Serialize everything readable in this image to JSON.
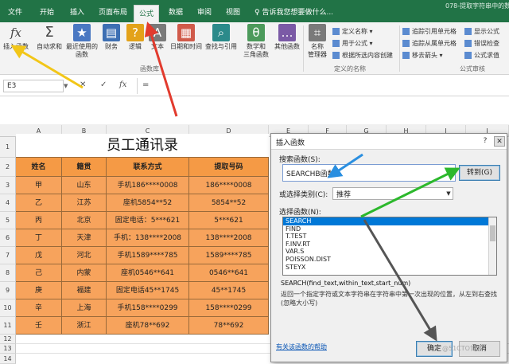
{
  "window": {
    "title_fragment": "078-提取字符串中的数字..."
  },
  "tabs": [
    {
      "label": "文件",
      "active": false
    },
    {
      "label": "开始",
      "active": false
    },
    {
      "label": "插入",
      "active": false
    },
    {
      "label": "页面布局",
      "active": false
    },
    {
      "label": "公式",
      "active": true
    },
    {
      "label": "数据",
      "active": false
    },
    {
      "label": "审阅",
      "active": false
    },
    {
      "label": "视图",
      "active": false
    }
  ],
  "tell_me": "告诉我您想要做什么...",
  "ribbon": {
    "insert_function": "插入函数",
    "autosum": "自动求和",
    "recent": "最近使用的\n函数",
    "financial": "财务",
    "logical": "逻辑",
    "text": "文本",
    "datetime": "日期和时间",
    "lookup": "查找与引用",
    "math": "数学和\n三角函数",
    "more": "其他函数",
    "name_manager": "名称\n管理器",
    "define_name": "定义名称 ▾",
    "use_in_formula": "用于公式 ▾",
    "create_from_selection": "根据所选内容创建",
    "trace_precedents": "追踪引用单元格",
    "trace_dependents": "追踪从属单元格",
    "remove_arrows": "移去箭头 ▾",
    "show_formulas": "显示公式",
    "error_checking": "错误检查",
    "evaluate_formula": "公式求值",
    "group_library": "函数库",
    "group_names": "定义的名称",
    "group_audit": "公式审核"
  },
  "formula_bar": {
    "name_box": "E3",
    "cancel": "✕",
    "enter": "✓",
    "fx": "fx",
    "content": "="
  },
  "columns": [
    "A",
    "B",
    "C",
    "D",
    "E",
    "F",
    "G",
    "H",
    "I",
    "J"
  ],
  "rows": [
    "1",
    "2",
    "3",
    "4",
    "5",
    "6",
    "7",
    "8",
    "9",
    "10",
    "11",
    "12",
    "13",
    "14"
  ],
  "sheet": {
    "title": "员工通讯录",
    "headers": [
      "姓名",
      "籍贯",
      "联系方式",
      "提取号码"
    ],
    "data": [
      [
        "甲",
        "山东",
        "手机186****0008",
        "186****0008"
      ],
      [
        "乙",
        "江苏",
        "座机5854**52",
        "5854**52"
      ],
      [
        "丙",
        "北京",
        "固定电话：5***621",
        "5***621"
      ],
      [
        "丁",
        "天津",
        "手机：138****2008",
        "138****2008"
      ],
      [
        "戊",
        "河北",
        "手机1589****785",
        "1589****785"
      ],
      [
        "己",
        "内蒙",
        "座机0546**641",
        "0546**641"
      ],
      [
        "庚",
        "福建",
        "固定电话45**1745",
        "45**1745"
      ],
      [
        "辛",
        "上海",
        "手机158****0299",
        "158****0299"
      ],
      [
        "壬",
        "浙江",
        "座机78**692",
        "78**692"
      ]
    ]
  },
  "dialog": {
    "title": "插入函数",
    "help_btn": "?",
    "close_btn": "✕",
    "search_label": "搜索函数(S):",
    "search_value": "SEARCHB函数",
    "goto_btn": "转到(G)",
    "category_label": "或选择类别(C):",
    "category_value": "推荐",
    "select_label": "选择函数(N):",
    "functions": [
      "SEARCH",
      "FIND",
      "T.TEST",
      "F.INV.RT",
      "VAR.S",
      "POISSON.DIST",
      "STEYX"
    ],
    "selected_function": "SEARCH",
    "syntax": "SEARCH(find_text,within_text,start_num)",
    "description": "返回一个指定字符或文本字符串在字符串中第一次出现的位置，从左到右查找(忽略大小写)",
    "help_link": "有关该函数的帮助",
    "ok": "确定",
    "cancel": "取消"
  },
  "watermark": "@51CTO博客",
  "colors": {
    "tabbar": "#217346",
    "table_fill": "#f7a35c",
    "header_fill": "#f59a45",
    "selected": "#0078d7"
  }
}
